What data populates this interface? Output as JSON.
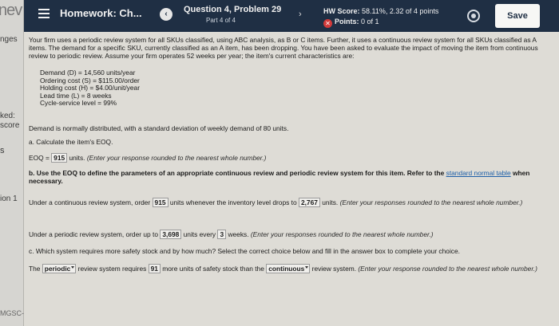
{
  "sidebar": {
    "top_fragment": "nev",
    "fragments": [
      "nges",
      "ked:",
      "score",
      "s",
      "ion 1",
      "MGSC-"
    ]
  },
  "header": {
    "hw_title": "Homework: Ch...",
    "prev_glyph": "‹",
    "question_title": "Question 4, Problem 29",
    "question_part": "Part 4 of 4",
    "next_glyph": "›",
    "hw_score_label": "HW Score:",
    "hw_score_value": "58.11%, 2.32 of 4 points",
    "points_icon": "x-circle-icon",
    "points_label": "Points:",
    "points_value": "0 of 1",
    "settings_icon": "gear-icon",
    "save_label": "Save"
  },
  "problem": {
    "intro": "Your firm uses a periodic review system for all SKUs classified, using ABC analysis, as B or C items. Further, it uses a continuous review system for all SKUs classified as A items. The demand for a specific SKU, currently classified as an A item, has been dropping. You have been asked to evaluate the impact of moving the item from continuous review to periodic review. Assume your firm operates 52 weeks per year; the item's current characteristics are:",
    "params": [
      "Demand (D) = 14,560 units/year",
      "Ordering cost (S) = $115.00/order",
      "Holding cost (H) = $4.00/unit/year",
      "Lead time (L) = 8 weeks",
      "Cycle-service level = 99%"
    ],
    "demand_note": "Demand is normally distributed, with a standard deviation of weekly demand of 80 units.",
    "part_a": "a. Calculate the item's EOQ.",
    "eoq_label": "EOQ =",
    "eoq_value": "915",
    "eoq_units": "units.",
    "eoq_hint": "(Enter your response rounded to the nearest whole number.)",
    "part_b_pre": "b. Use the EOQ to define the parameters of an appropriate continuous review and periodic review system for this item. Refer to the",
    "part_b_link": "standard normal table",
    "part_b_post": "when necessary.",
    "cont_pre": "Under a continuous review system, order",
    "cont_qty": "915",
    "cont_mid": "units whenever the inventory level drops to",
    "cont_reorder": "2,767",
    "cont_units": "units.",
    "cont_hint": "(Enter your responses rounded to the nearest whole number.)",
    "per_pre": "Under a periodic review system, order up to",
    "per_target": "3,698",
    "per_mid": "units every",
    "per_weeks": "3",
    "per_post": "weeks.",
    "per_hint": "(Enter your responses rounded to the nearest whole number.)",
    "part_c": "c. Which system requires more safety stock and by how much? Select the correct choice below and fill in the answer box to complete your choice.",
    "c_the": "The",
    "c_system": "periodic",
    "c_mid": "review system requires",
    "c_amount": "91",
    "c_mid2": "more units of safety stock than the",
    "c_other": "continuous",
    "c_post": "review system.",
    "c_hint": "(Enter your response rounded to the nearest whole number.)"
  }
}
